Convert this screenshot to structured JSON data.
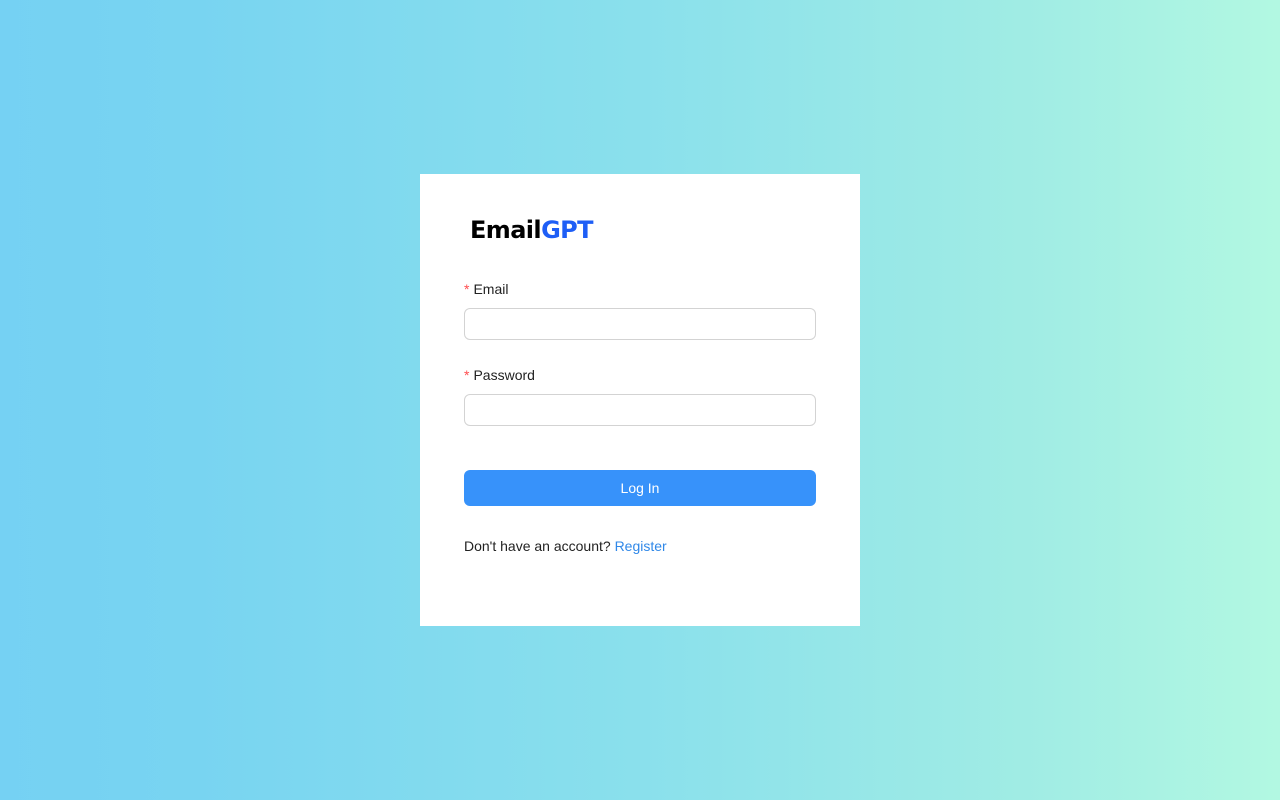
{
  "brand": {
    "logo_part1": "Email",
    "logo_part2": "GPT",
    "logo_part1_color": "#000000",
    "logo_part2_color": "#1e5ef6"
  },
  "form": {
    "required_marker": "*",
    "email_label": "Email",
    "email_value": "",
    "password_label": "Password",
    "password_value": "",
    "submit_label": "Log In",
    "submit_color": "#3792fa"
  },
  "footer": {
    "prompt": "Don't have an account?",
    "register_link": "Register",
    "link_color": "#3088e8"
  },
  "colors": {
    "background_start": "#75d1f3",
    "background_end": "#b2f8e2",
    "required_marker": "#ff4d4f"
  }
}
